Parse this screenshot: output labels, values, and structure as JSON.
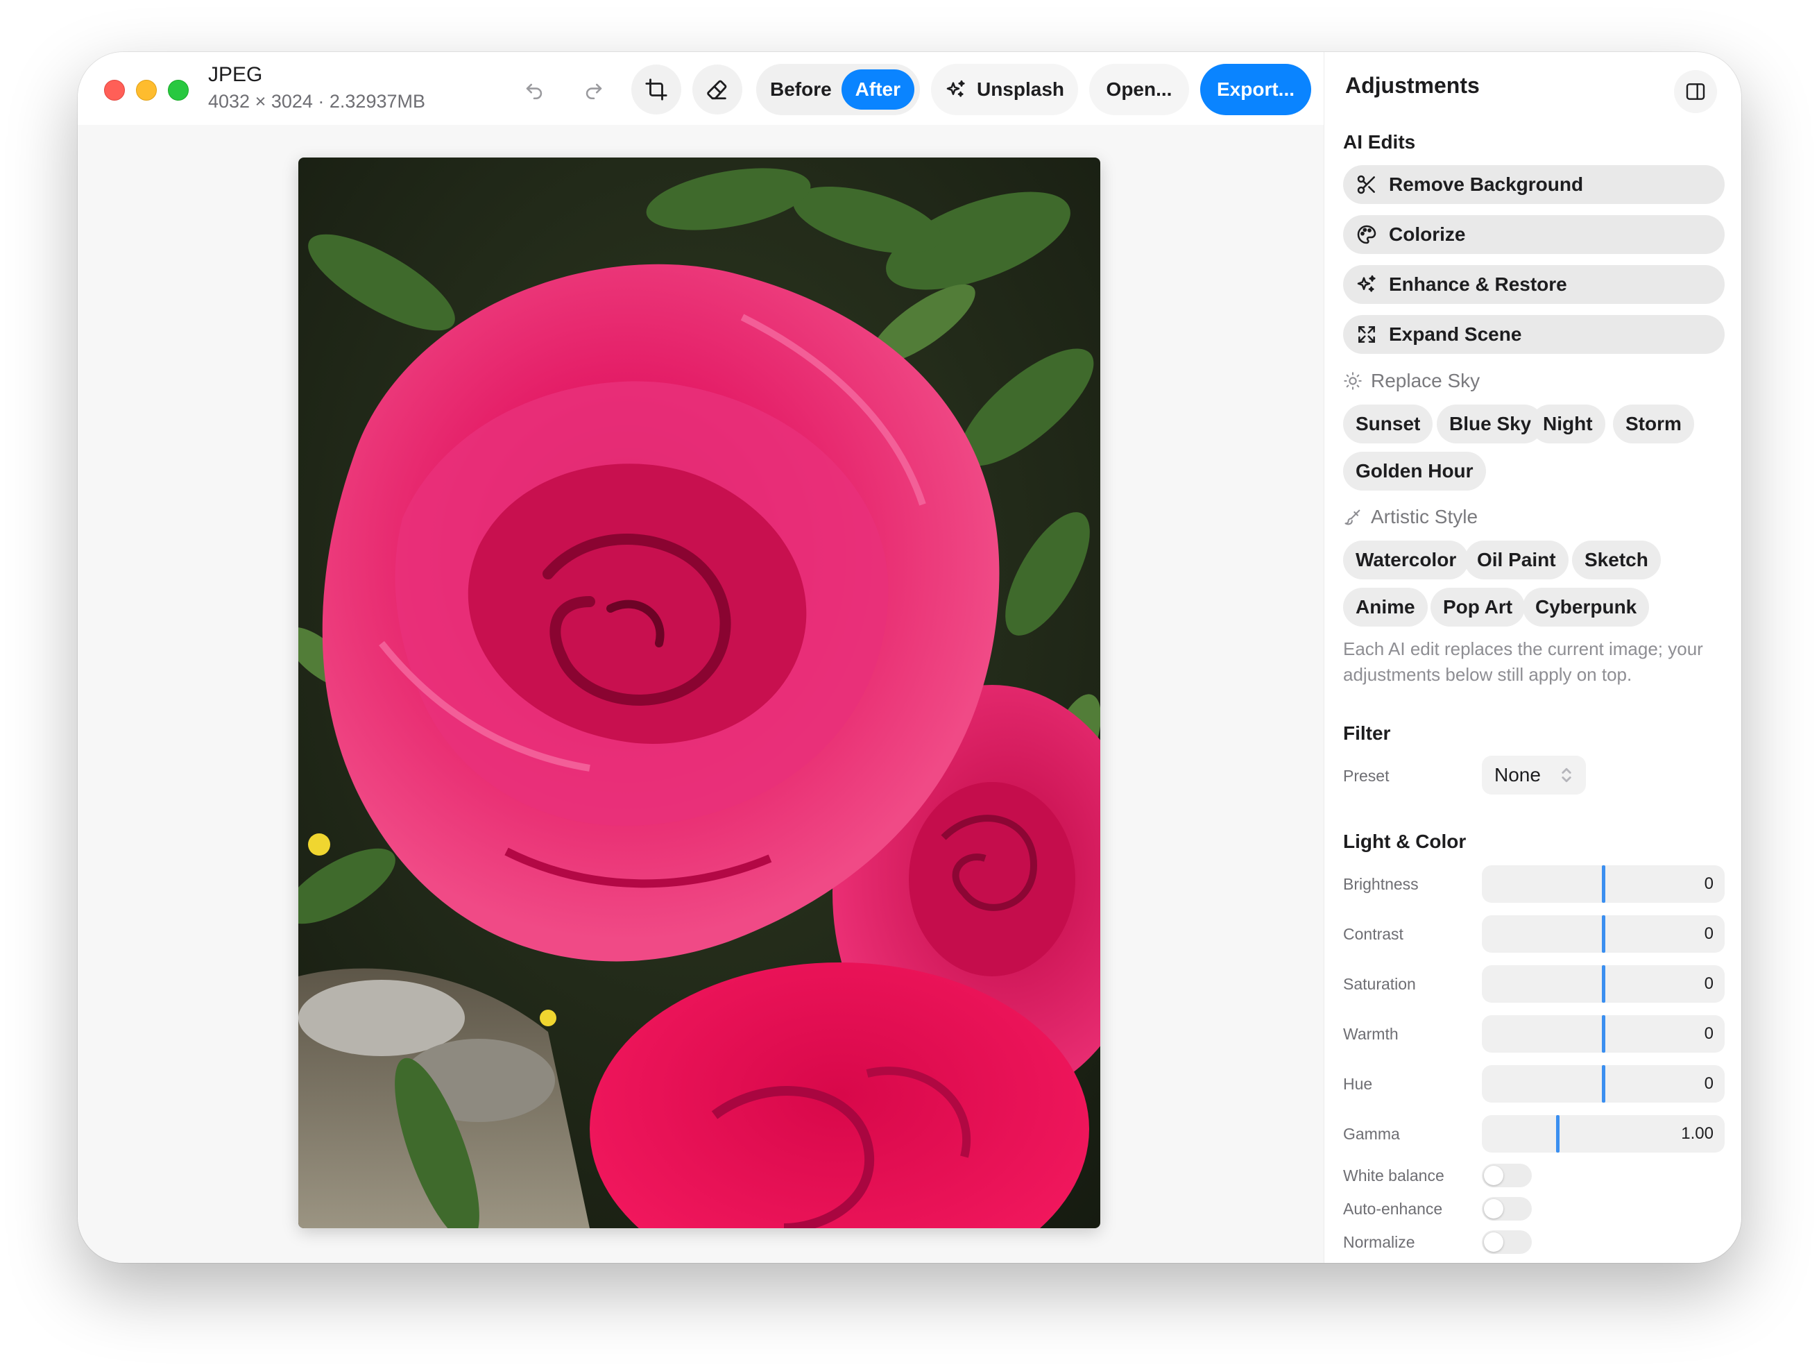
{
  "window": {
    "file_title": "JPEG",
    "file_info": "4032 × 3024 · 2.32937MB"
  },
  "toolbar": {
    "undo_icon": "undo-icon",
    "redo_icon": "redo-icon",
    "crop_icon": "crop-icon",
    "eraser_icon": "eraser-icon",
    "before_label": "Before",
    "after_label": "After",
    "unsplash_label": "Unsplash",
    "open_label": "Open...",
    "export_label": "Export..."
  },
  "sidebar": {
    "title": "Adjustments",
    "ai_edits": {
      "title": "AI Edits",
      "buttons": [
        {
          "label": "Remove Background",
          "icon": "scissors-icon"
        },
        {
          "label": "Colorize",
          "icon": "palette-icon"
        },
        {
          "label": "Enhance & Restore",
          "icon": "sparkles-icon"
        },
        {
          "label": "Expand Scene",
          "icon": "expand-icon"
        }
      ],
      "replace_sky": {
        "label": "Replace Sky",
        "options": [
          "Sunset",
          "Blue Sky",
          "Night",
          "Storm",
          "Golden Hour"
        ]
      },
      "artistic_style": {
        "label": "Artistic Style",
        "options": [
          "Watercolor",
          "Oil Paint",
          "Sketch",
          "Anime",
          "Pop Art",
          "Cyberpunk"
        ]
      },
      "note": "Each AI edit replaces the current image; your adjustments below still apply on top."
    },
    "filter": {
      "title": "Filter",
      "preset_label": "Preset",
      "preset_value": "None"
    },
    "light_color": {
      "title": "Light & Color",
      "sliders": [
        {
          "label": "Brightness",
          "value": "0",
          "position": 0.5
        },
        {
          "label": "Contrast",
          "value": "0",
          "position": 0.5
        },
        {
          "label": "Saturation",
          "value": "0",
          "position": 0.5
        },
        {
          "label": "Warmth",
          "value": "0",
          "position": 0.5
        },
        {
          "label": "Hue",
          "value": "0",
          "position": 0.5
        },
        {
          "label": "Gamma",
          "value": "1.00",
          "position": 0.31
        }
      ],
      "toggles": [
        {
          "label": "White balance",
          "on": false
        },
        {
          "label": "Auto-enhance",
          "on": false
        },
        {
          "label": "Normalize",
          "on": false
        }
      ]
    }
  },
  "colors": {
    "accent": "#0a84ff",
    "slider_thumb": "#3b8ff0",
    "rose": "#e0105a"
  }
}
